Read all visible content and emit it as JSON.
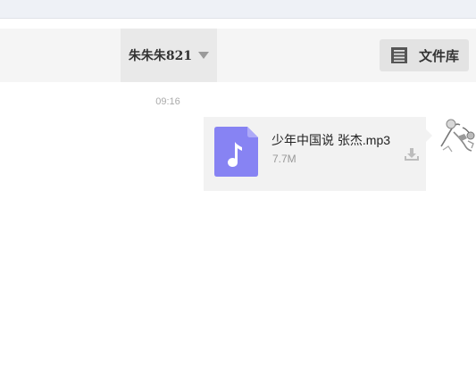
{
  "header": {
    "user_name": "朱朱朱821",
    "library_label": "文件库"
  },
  "chat": {
    "timestamp": "09:16",
    "message": {
      "file_name": "少年中国说 张杰.mp3",
      "file_size": "7.7M",
      "file_type_icon": "music-note-icon",
      "accent_color": "#8783f3"
    }
  },
  "icons": {
    "library": "file-library-icon",
    "download": "download-icon",
    "dropdown": "caret-down-icon"
  }
}
